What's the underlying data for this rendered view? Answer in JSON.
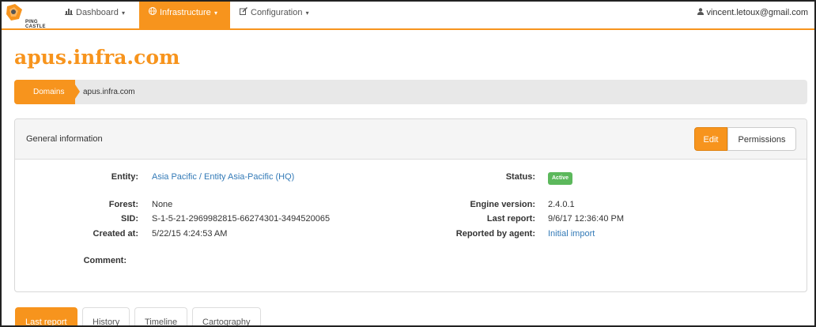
{
  "logo": {
    "text": "PING CASTLE"
  },
  "navbar": {
    "items": [
      {
        "label": "Dashboard",
        "icon": "bar-chart-icon",
        "active": false
      },
      {
        "label": "Infrastructure",
        "icon": "globe-icon",
        "active": true
      },
      {
        "label": "Configuration",
        "icon": "edit-icon",
        "active": false
      }
    ],
    "user": "vincent.letoux@gmail.com"
  },
  "page_title": "apus.infra.com",
  "breadcrumb": {
    "first": "Domains",
    "second": "apus.infra.com"
  },
  "panel": {
    "title": "General information",
    "edit_label": "Edit",
    "permissions_label": "Permissions"
  },
  "details": {
    "entity_label": "Entity:",
    "entity_value": "Asia Pacific / Entity Asia-Pacific (HQ)",
    "forest_label": "Forest:",
    "forest_value": "None",
    "sid_label": "SID:",
    "sid_value": "S-1-5-21-2969982815-66274301-3494520065",
    "created_label": "Created at:",
    "created_value": "5/22/15 4:24:53 AM",
    "comment_label": "Comment:",
    "status_label": "Status:",
    "status_value": "Active",
    "engine_label": "Engine version:",
    "engine_value": "2.4.0.1",
    "last_report_label": "Last report:",
    "last_report_value": "9/6/17 12:36:40 PM",
    "agent_label": "Reported by agent:",
    "agent_value": "Initial import"
  },
  "tabs": [
    {
      "label": "Last report",
      "active": true
    },
    {
      "label": "History",
      "active": false
    },
    {
      "label": "Timeline",
      "active": false
    },
    {
      "label": "Cartography",
      "active": false
    }
  ],
  "colors": {
    "accent": "#f7941d",
    "link": "#337ab7",
    "success": "#5cb85c"
  }
}
